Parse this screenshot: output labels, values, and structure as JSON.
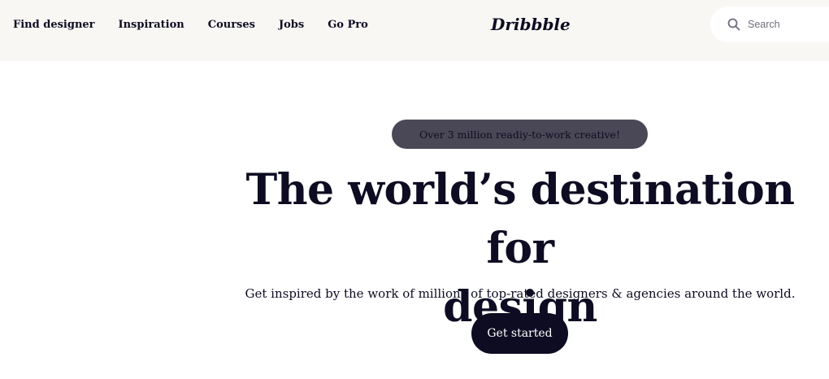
{
  "header": {
    "nav": [
      {
        "label": "Find designer",
        "name": "nav-find-designer"
      },
      {
        "label": "Inspiration",
        "name": "nav-inspiration"
      },
      {
        "label": "Courses",
        "name": "nav-courses"
      },
      {
        "label": "Jobs",
        "name": "nav-jobs"
      },
      {
        "label": "Go Pro",
        "name": "nav-go-pro"
      }
    ],
    "logo": "Dribbble",
    "search": {
      "placeholder": "Search",
      "icon": "search-icon"
    }
  },
  "hero": {
    "badge": "Over 3 million readiy-to-work creative!",
    "headline_line1": "The world’s destination for",
    "headline_line2": "design",
    "subtitle": "Get inspired by the work of millions of top-rated designers & agencies around the world.",
    "cta": "Get started"
  },
  "colors": {
    "header_bg": "#f8f7f4",
    "text": "#0d0c22",
    "badge_bg": "#4a4856",
    "cta_bg": "#0d0c22",
    "cta_text": "#ffffff"
  }
}
